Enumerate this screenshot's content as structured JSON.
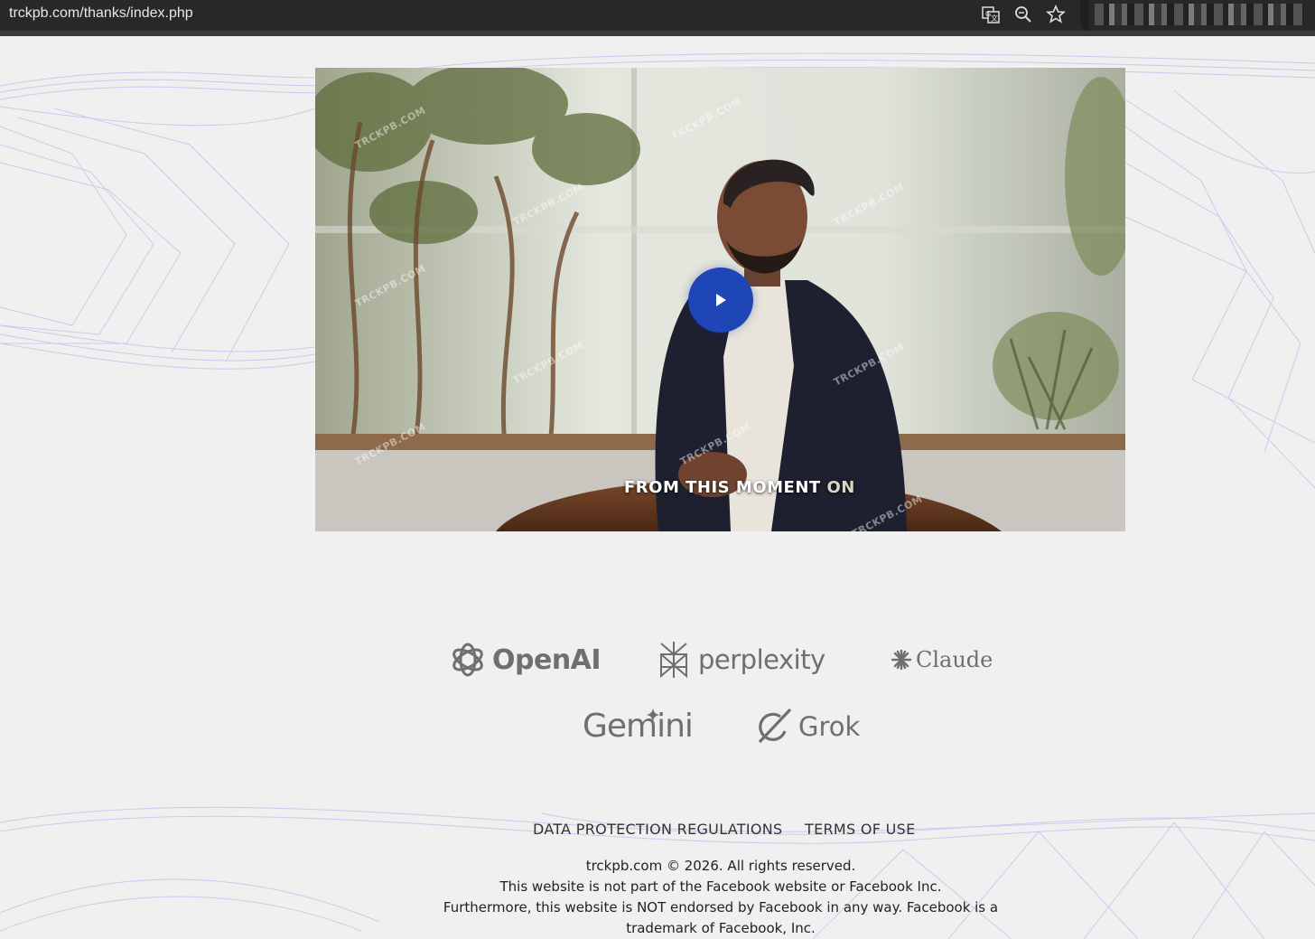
{
  "browser": {
    "url": "trckpb.com/thanks/index.php",
    "icons": [
      "translate-icon",
      "zoom-icon",
      "bookmark-star-icon"
    ]
  },
  "video": {
    "caption_main": "FROM THIS MOMENT",
    "caption_tail": "ON",
    "watermark": "TRCKPB.COM",
    "play_color": "#1f46b6"
  },
  "logos": {
    "openai": "OpenAI",
    "perplexity": "perplexity",
    "claude": "Claude",
    "gemini": "Gemini",
    "grok": "Grok"
  },
  "footer": {
    "links": {
      "data_protection": "DATA PROTECTION REGULATIONS",
      "terms": "TERMS OF USE"
    },
    "copyright": "trckpb.com © 2026. All rights reserved.",
    "disclaimer1": "This website is not part of the Facebook website or Facebook Inc.",
    "disclaimer2": "Furthermore, this website is NOT endorsed by Facebook in any way. Facebook is a trademark of Facebook, Inc."
  }
}
